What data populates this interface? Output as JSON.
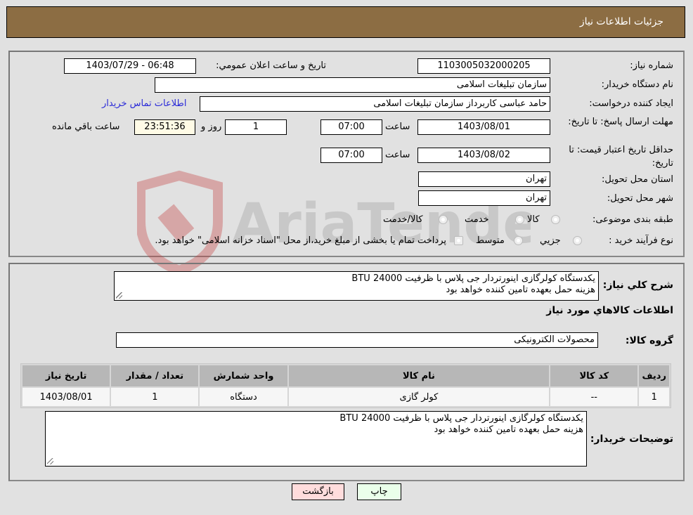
{
  "header": {
    "title": "جزئیات اطلاعات نیاز"
  },
  "form": {
    "need_number_label": "شماره نیاز:",
    "need_number": "1103005032000205",
    "announce_label": "تاریخ و ساعت اعلان عمومي:",
    "announce_value": "1403/07/29 - 06:48",
    "buyer_org_label": "نام دستگاه خریدار:",
    "buyer_org": "سازمان تبلیغات اسلامی",
    "creator_label": "ایجاد کننده درخواست:",
    "creator": "حامد عباسی کاربرداز سازمان تبلیغات اسلامی",
    "contact_link": "اطلاعات تماس خریدار",
    "reply_deadline_label": "مهلت ارسال پاسخ: تا تاریخ:",
    "reply_date": "1403/08/01",
    "time_label": "ساعت",
    "reply_time": "07:00",
    "days_value": "1",
    "days_label": "روز و",
    "remaining_time": "23:51:36",
    "remaining_label": "ساعت باقي مانده",
    "price_validity_label": "حداقل تاریخ اعتبار قیمت: تا تاریخ:",
    "price_date": "1403/08/02",
    "price_time": "07:00",
    "province_label": "استان محل تحویل:",
    "province": "تهران",
    "city_label": "شهر محل تحویل:",
    "city": "تهران",
    "category_label": "طبقه بندی موضوعی:",
    "category_options": [
      "کالا",
      "خدمت",
      "کالا/خدمت"
    ],
    "process_label": "نوع فرآیند خرید :",
    "process_options": [
      "جزیي",
      "متوسط"
    ],
    "process_note": "پرداخت تمام یا بخشی از مبلغ خرید،از محل \"اسناد خزانه اسلامی\" خواهد بود."
  },
  "details": {
    "summary_label": "شرح کلي نیاز:",
    "summary_line1": "یکدستگاه کولرگازی اینورتردار جی پلاس با ظرفیت 24000 BTU",
    "summary_line2": "هزینه حمل بعهده تامین کننده خواهد بود",
    "goods_info_title": "اطلاعات کالاهاي مورد نیاز",
    "goods_group_label": "گروه کالا:",
    "goods_group": "محصولات الکترونیکی",
    "table": {
      "headers": [
        "ردیف",
        "کد کالا",
        "نام کالا",
        "واحد شمارش",
        "تعداد / مقدار",
        "تاریخ نیاز"
      ],
      "rows": [
        [
          "1",
          "--",
          "کولر گازی",
          "دستگاه",
          "1",
          "1403/08/01"
        ]
      ]
    },
    "buyer_notes_label": "توضیحات خریدار:",
    "buyer_notes_line1": "یکدستگاه کولرگازی اینورتردار جی پلاس با ظرفیت 24000 BTU",
    "buyer_notes_line2": "هزینه حمل بعهده تامین کننده خواهد بود"
  },
  "buttons": {
    "print": "چاپ",
    "back": "بازگشت"
  },
  "watermark": {
    "text": "AriaTender.neT"
  },
  "colors": {
    "header_bg": "#8c6d43",
    "print_bg": "#eaffea",
    "back_bg": "#ffdcdc",
    "link": "#2a2ad8"
  }
}
